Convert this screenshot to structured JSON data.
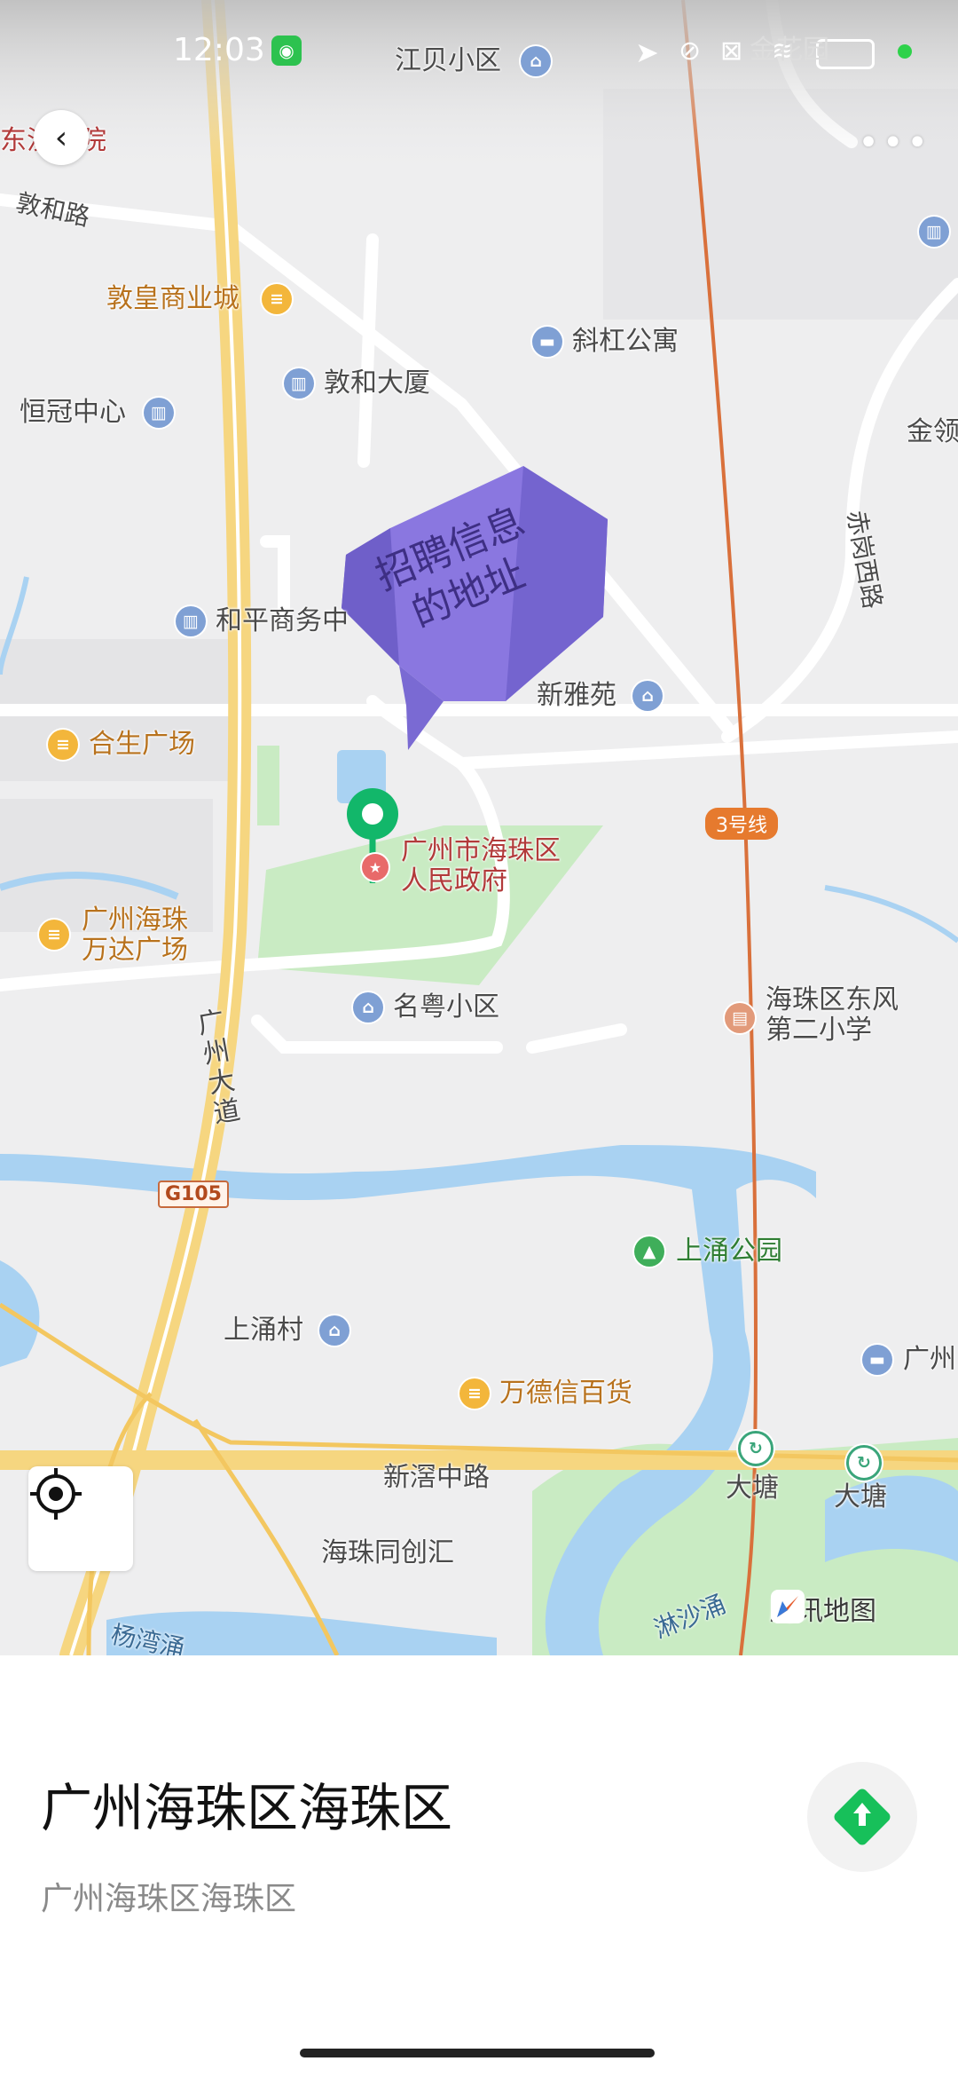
{
  "status_bar": {
    "time": "12:03"
  },
  "map": {
    "labels": {
      "jiangbei": "江贝小区",
      "hospital_partial": "东汉医院",
      "dunhe_road": "敦和路",
      "dunhuang_mall": "敦皇商业城",
      "xiegang_apt": "斜杠公寓",
      "dunhe_building": "敦和大厦",
      "hengguan": "恒冠中心",
      "jinling_partial": "金领",
      "chigang_road": "赤岗西路",
      "heping": "和平商务中",
      "xinyayuan": "新雅苑",
      "hesheng": "合生广场",
      "metro_line": "3号线",
      "gov_line1": "广州市海珠区",
      "gov_line2": "人民政府",
      "wanda_line1": "广州海珠",
      "wanda_line2": "万达广场",
      "mingyue": "名粤小区",
      "school_line1": "海珠区东风",
      "school_line2": "第二小学",
      "guangzhou_avenue": "广州大道",
      "g105": "G105",
      "shangchong_park": "上涌公园",
      "shangchong_village": "上涌村",
      "guangzhou_partial": "广州",
      "wandexin": "万德信百货",
      "xinjiao_road": "新滘中路",
      "datang1": "大塘",
      "datang2": "大塘",
      "haizhu_chuanghui": "海珠同创汇",
      "linsha": "淋沙涌",
      "yangwan": "杨湾涌",
      "top_right_partial": "金花园"
    },
    "bubble": {
      "line1": "招聘信息",
      "line2": "的地址"
    },
    "brand": "腾讯地图"
  },
  "place": {
    "title": "广州海珠区海珠区",
    "subtitle": "广州海珠区海珠区"
  },
  "icons": {
    "back": "back-arrow-icon",
    "more": "more-dots-icon",
    "locate": "locate-crosshair-icon",
    "navigate": "navigation-arrow-icon",
    "pin": "map-pin-icon"
  },
  "colors": {
    "pin_green": "#12b76a",
    "bubble_purple": "#8a77e0",
    "nav_green": "#17c05a",
    "road_yellow": "#f6d680",
    "water_blue": "#a9d2f2",
    "park_green": "#c9ebc3"
  }
}
